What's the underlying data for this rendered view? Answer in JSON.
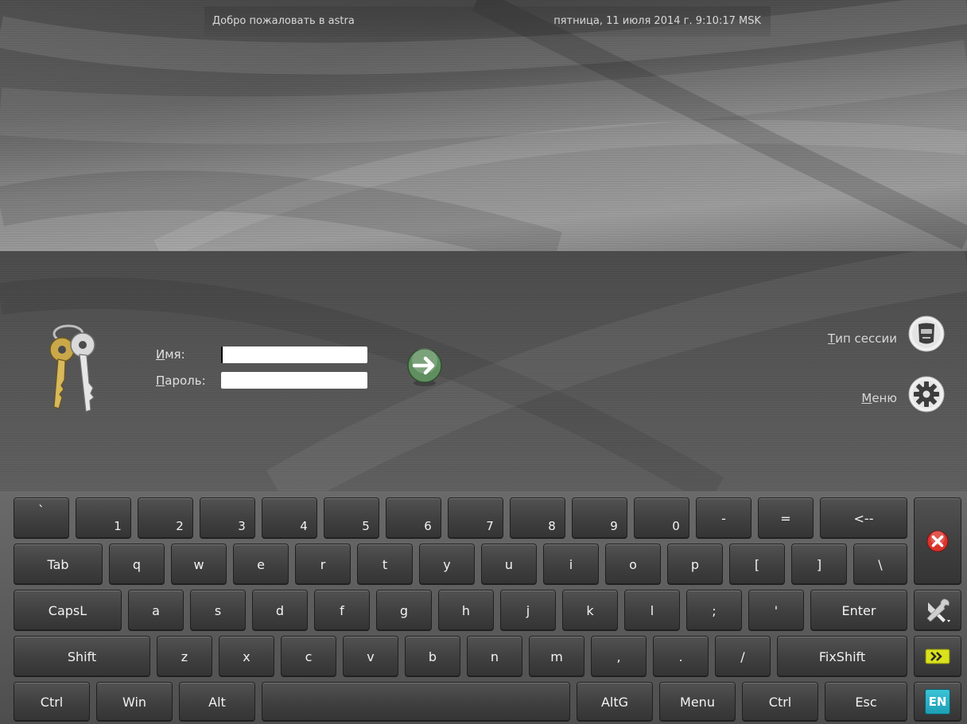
{
  "topbar": {
    "welcome": "Добро пожаловать в astra",
    "datetime": "пятница, 11 июля 2014 г. 9:10:17 MSK"
  },
  "login": {
    "username_label_mnemonic": "И",
    "username_label_rest": "мя:",
    "password_label_mnemonic": "П",
    "password_label_rest": "ароль:",
    "username_value": "",
    "password_value": ""
  },
  "side": {
    "session_type_mnemonic": "Т",
    "session_type_rest": "ип сессии",
    "menu_mnemonic": "М",
    "menu_rest": "еню"
  },
  "keyboard": {
    "row1": [
      "`",
      "1",
      "2",
      "3",
      "4",
      "5",
      "6",
      "7",
      "8",
      "9",
      "0",
      "-",
      "=",
      "<--"
    ],
    "row2": [
      "Tab",
      "q",
      "w",
      "e",
      "r",
      "t",
      "y",
      "u",
      "i",
      "o",
      "p",
      "[",
      "]",
      "\\"
    ],
    "row3": [
      "CapsL",
      "a",
      "s",
      "d",
      "f",
      "g",
      "h",
      "j",
      "k",
      "l",
      ";",
      "'",
      "Enter"
    ],
    "row4": [
      "Shift",
      "z",
      "x",
      "c",
      "v",
      "b",
      "n",
      "m",
      ",",
      ".",
      "/",
      "FixShift"
    ],
    "row5": [
      "Ctrl",
      "Win",
      "Alt",
      "",
      "AltG",
      "Menu",
      "Ctrl",
      "Esc"
    ],
    "layout_indicator": "EN"
  },
  "colors": {
    "close_red": "#d9342b",
    "go_green": "#5f8f5f",
    "layout_teal": "#1e9fb4",
    "arrow_yellow": "#d9e21c"
  },
  "icons": {
    "keys": "keys-icon",
    "go": "arrow-right-circle-icon",
    "session": "session-type-icon",
    "menu": "gear-icon",
    "close": "close-icon",
    "settings": "tools-icon",
    "hide": "double-arrow-icon"
  }
}
